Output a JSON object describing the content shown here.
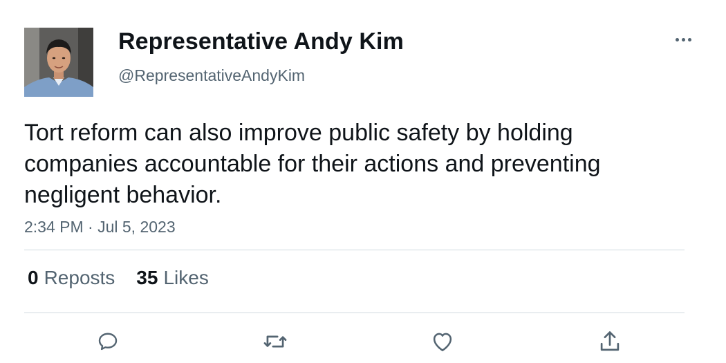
{
  "author": {
    "display_name": "Representative Andy Kim",
    "handle": "@RepresentativeAndyKim",
    "avatar_icon": "profile-photo"
  },
  "tweet": {
    "text": "Tort reform can also improve public safety by holding companies accountable for their actions and preventing negligent behavior.",
    "timestamp": "2:34 PM · Jul 5, 2023"
  },
  "stats": {
    "reposts_count": "0",
    "reposts_label": "Reposts",
    "likes_count": "35",
    "likes_label": "Likes"
  },
  "actions": [
    {
      "name": "reply",
      "icon": "speech-bubble-icon"
    },
    {
      "name": "repost",
      "icon": "repost-arrows-icon"
    },
    {
      "name": "like",
      "icon": "heart-icon"
    },
    {
      "name": "share",
      "icon": "share-upload-icon"
    }
  ],
  "colors": {
    "text_primary": "#0f1419",
    "text_secondary": "#536471",
    "divider": "#cfd9de",
    "background": "#ffffff"
  }
}
